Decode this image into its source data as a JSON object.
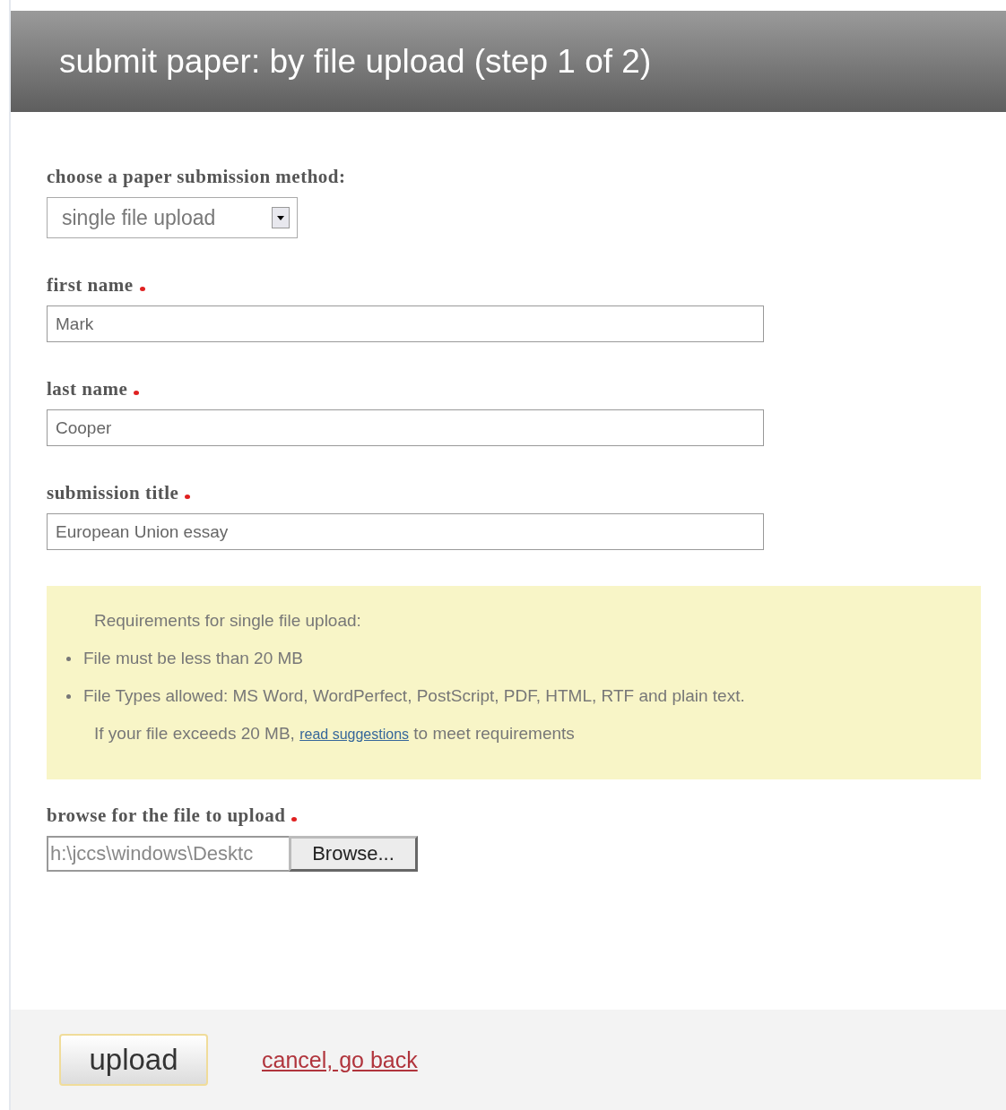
{
  "header": {
    "title": "submit paper: by file upload (step 1 of 2)"
  },
  "method": {
    "label": "choose a paper submission method:",
    "value": "single file upload"
  },
  "fields": [
    {
      "label": "first name",
      "required": true,
      "value": "Mark"
    },
    {
      "label": "last name",
      "required": true,
      "value": "Cooper"
    },
    {
      "label": "submission title",
      "required": true,
      "value": "European Union essay"
    }
  ],
  "requirements": {
    "heading": "Requirements for single file upload:",
    "items": [
      "File must be less than 20 MB",
      "File Types allowed: MS Word, WordPerfect, PostScript, PDF, HTML, RTF and plain text."
    ],
    "note": {
      "before": "If your file exceeds 20 MB, ",
      "link": "read suggestions",
      "after": " to meet requirements"
    }
  },
  "file": {
    "label": "browse for the file to upload",
    "required": true,
    "value": "h:\\jccs\\windows\\Desktc",
    "button": "Browse..."
  },
  "footer": {
    "submit": "upload",
    "cancel": "cancel, go back"
  }
}
